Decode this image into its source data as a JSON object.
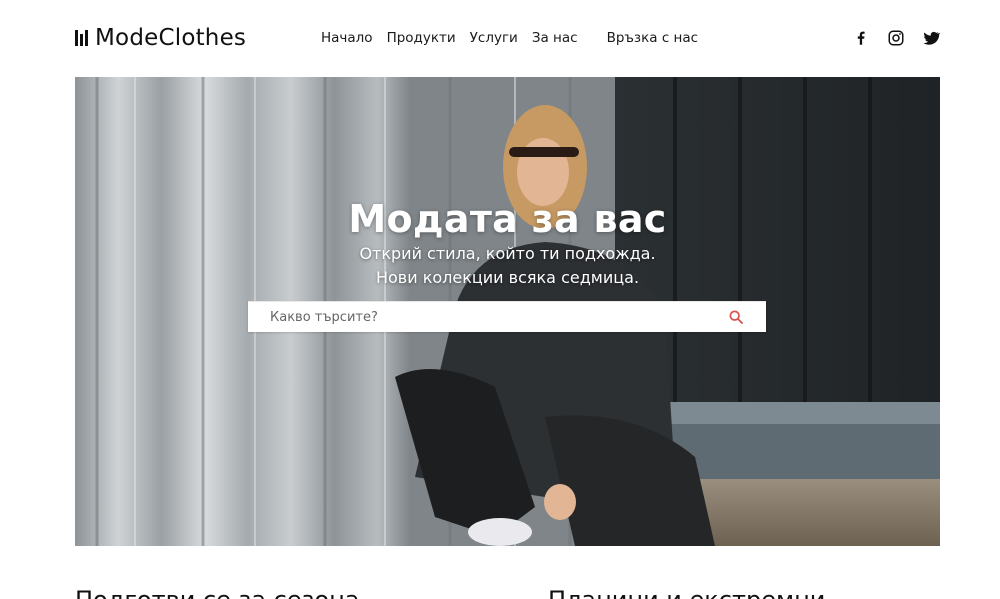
{
  "brand": {
    "name": "ModeClothes"
  },
  "nav": {
    "items": [
      {
        "label": "Начало"
      },
      {
        "label": "Продукти"
      },
      {
        "label": "Услуги"
      },
      {
        "label": "За нас"
      },
      {
        "label": "Връзка с нас"
      }
    ]
  },
  "social": [
    {
      "icon": "facebook-icon"
    },
    {
      "icon": "instagram-icon"
    },
    {
      "icon": "twitter-icon"
    }
  ],
  "hero": {
    "title": "Модата за вас",
    "subtitle_line1": "Открий стила, който ти подхожда.",
    "subtitle_line2": "Нови колекции всяка седмица.",
    "search": {
      "placeholder": "Какво търсите?",
      "value": "",
      "button_icon": "search-icon",
      "icon_color": "#d9534f"
    }
  },
  "sections": {
    "left_title": "Подготви се за сезона",
    "right_title": "Планини и екстремни"
  }
}
